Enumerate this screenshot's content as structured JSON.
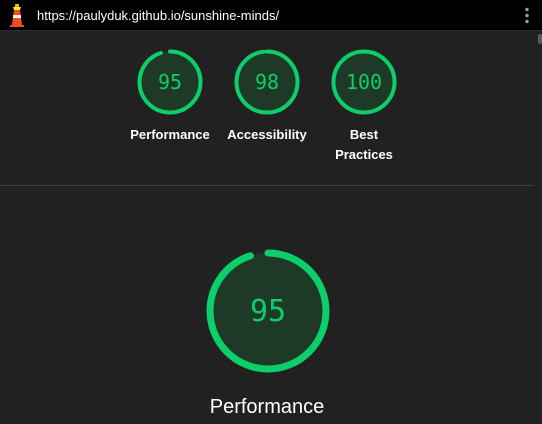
{
  "topbar": {
    "url": "https://paulyduk.github.io/sunshine-minds/",
    "logo_icon": "lighthouse-icon",
    "menu_icon": "more-vertical-icon"
  },
  "colors": {
    "pass": "#0cce6b",
    "pass_fill": "#1e3a27",
    "background": "#212121",
    "topbar": "#000000"
  },
  "scores": [
    {
      "label": "Performance",
      "value": 95
    },
    {
      "label": "Accessibility",
      "value": 98
    },
    {
      "label": "Best Practices",
      "value": 100,
      "label_lines": [
        "Best",
        "Practices"
      ]
    }
  ],
  "main": {
    "title": "Performance",
    "value": 95
  }
}
